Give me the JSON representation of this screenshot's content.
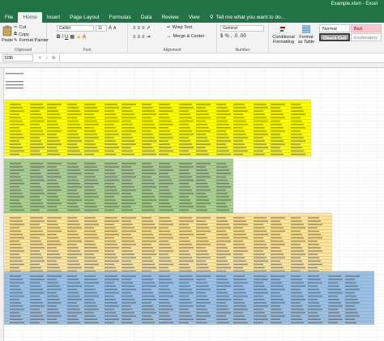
{
  "window": {
    "title": "Example.xlsm - Excel"
  },
  "tabs": [
    "File",
    "Home",
    "Insert",
    "Page Layout",
    "Formulas",
    "Data",
    "Review",
    "View"
  ],
  "tell_me": "Tell me what you want to do...",
  "ribbon": {
    "paste": "Paste",
    "cut": "Cut",
    "copy": "Copy",
    "format_painter": "Format Painter",
    "clipboard_label": "Clipboard",
    "font_name": "Calibri",
    "font_size": "11",
    "font_label": "Font",
    "wrap_text": "Wrap Text",
    "merge_center": "Merge & Center",
    "alignment_label": "Alignment",
    "number_format": "General",
    "number_label": "Number",
    "conditional_formatting": "Conditional Formatting",
    "format_as_table": "Format as Table",
    "styles": {
      "normal": "Normal",
      "bad": "Bad",
      "check_cell": "Check Cell",
      "explanatory": "Explanatory"
    }
  },
  "formula_bar": {
    "name_box": "D36",
    "fx": "fx"
  },
  "colors": {
    "excel_green": "#217346",
    "yellow": "#ffff00",
    "green": "#a9d08e",
    "orange": "#ffe699",
    "blue": "#9bc2e6"
  },
  "sheet": {
    "blocks": [
      {
        "name": "yellow",
        "color": "#ffff00",
        "rows": 17
      },
      {
        "name": "green",
        "color": "#a9d08e",
        "rows": 17
      },
      {
        "name": "orange",
        "color": "#ffe699",
        "rows": 18
      },
      {
        "name": "blue",
        "color": "#9bc2e6",
        "rows": 16
      }
    ]
  }
}
